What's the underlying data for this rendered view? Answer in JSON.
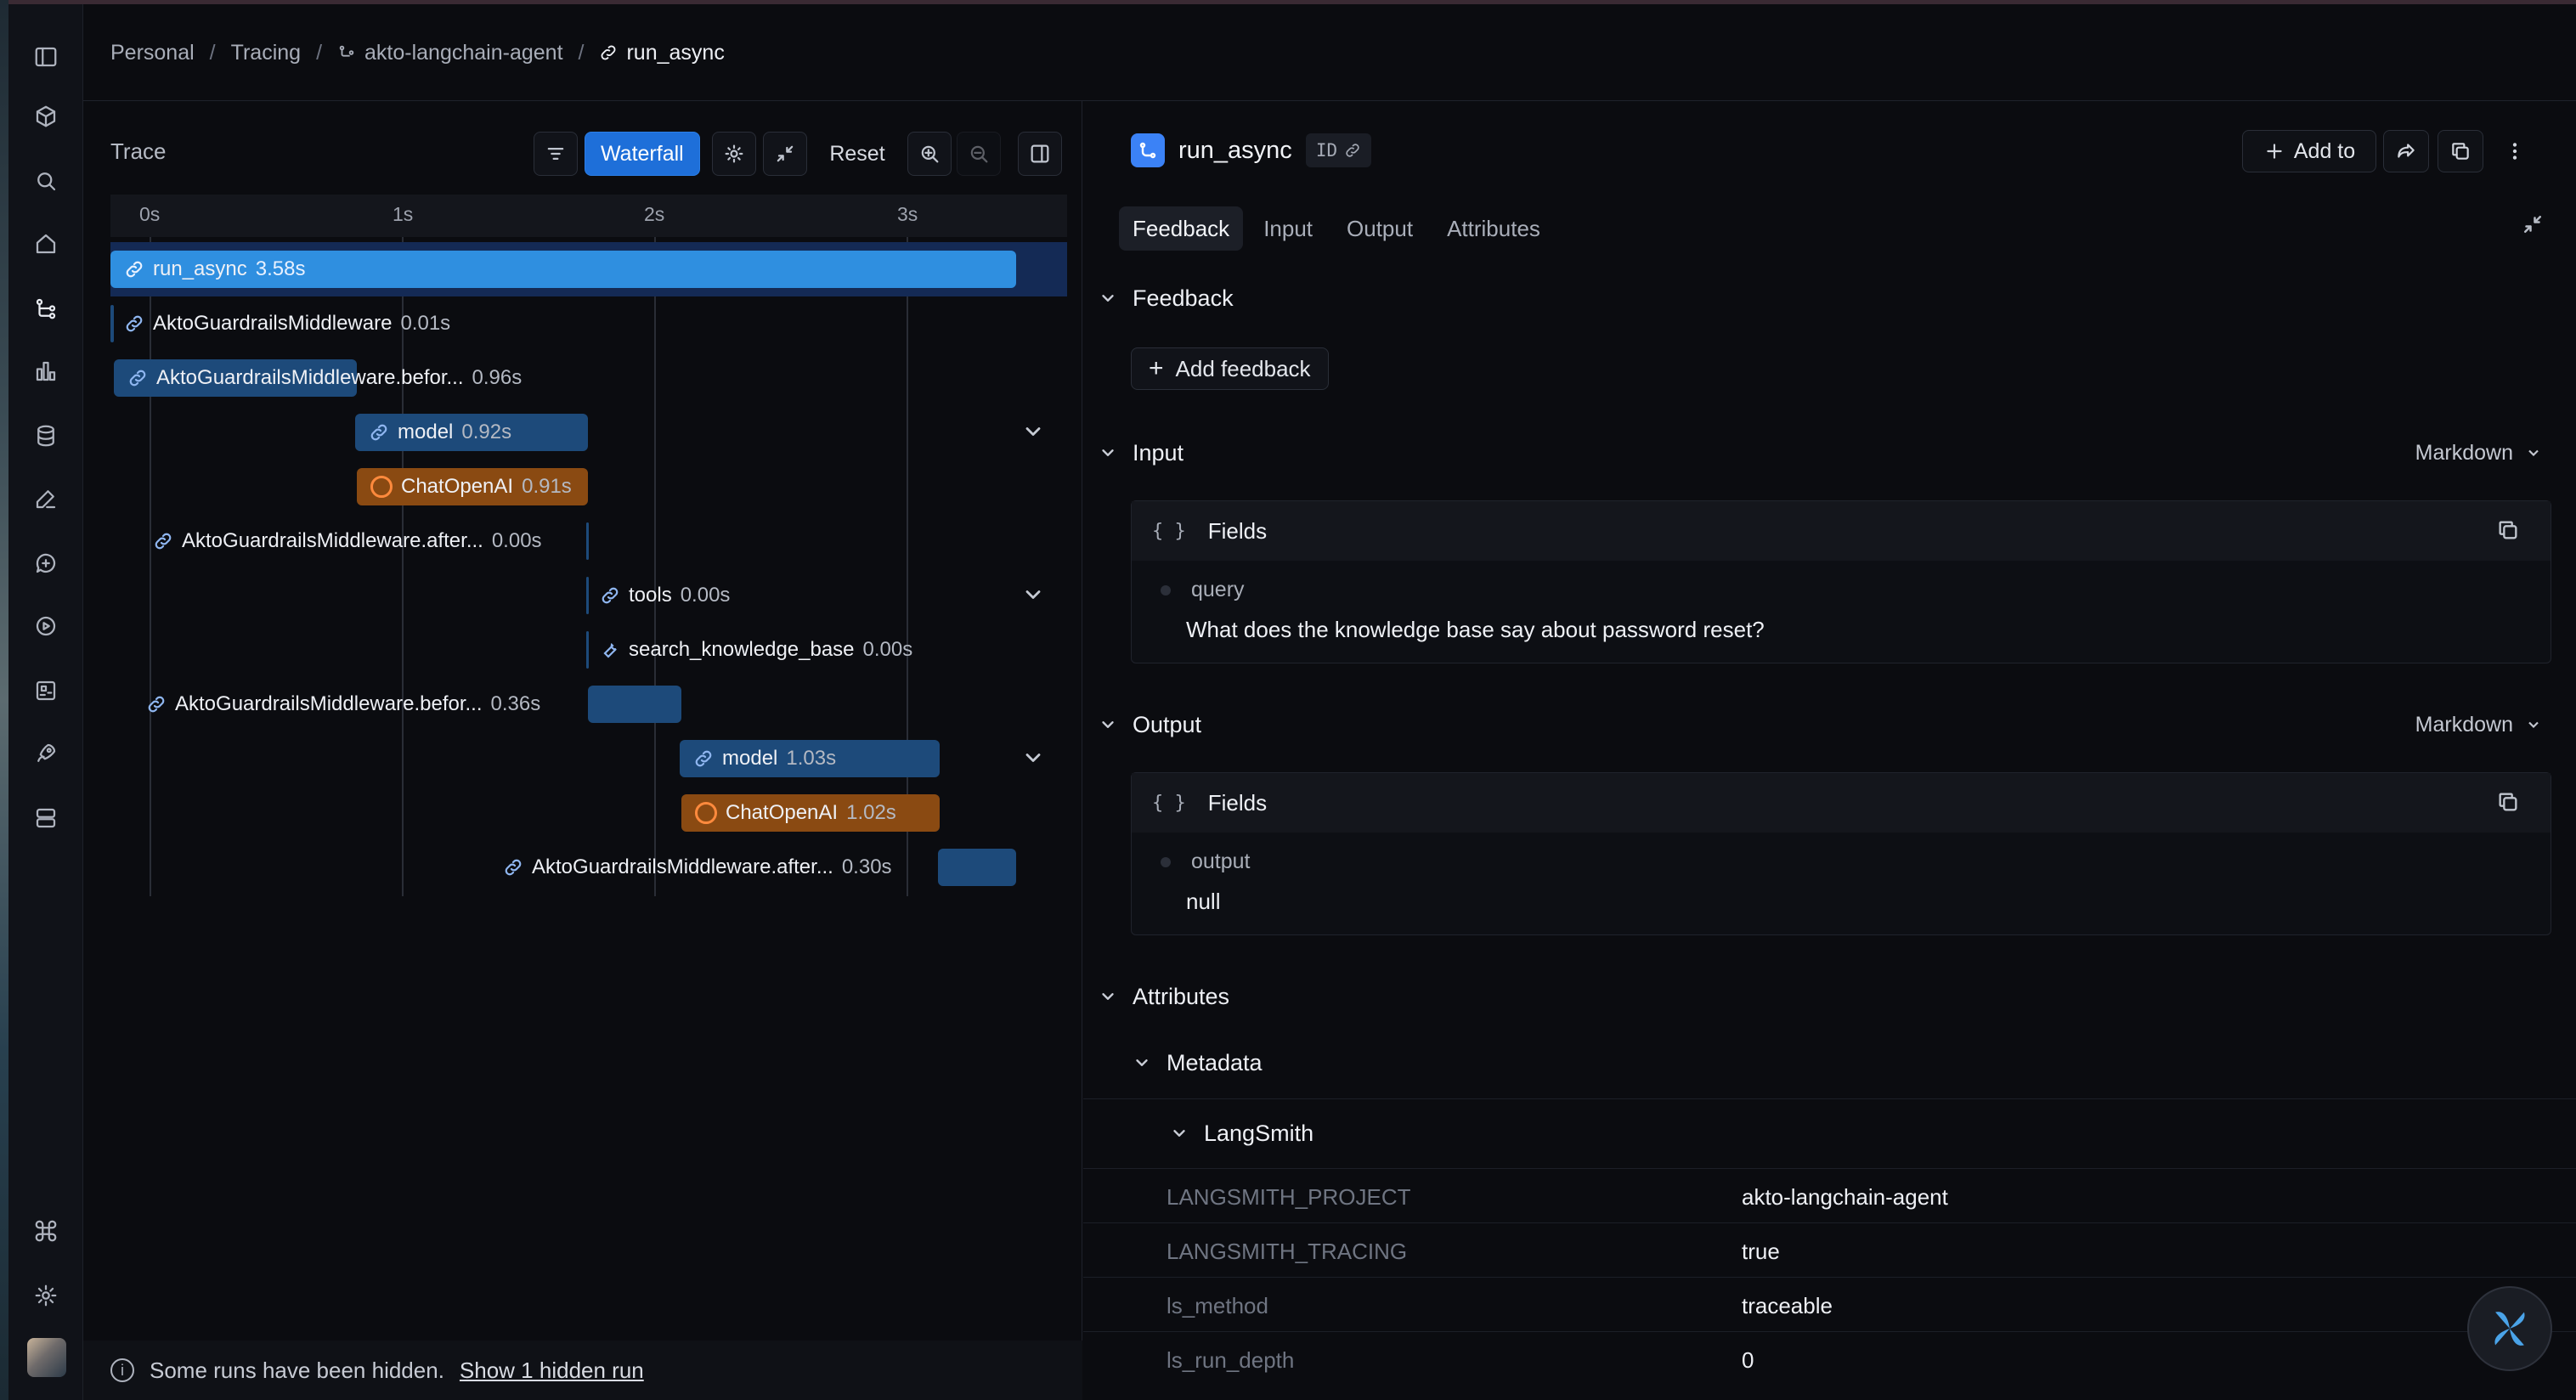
{
  "breadcrumb": {
    "items": [
      "Personal",
      "Tracing",
      "akto-langchain-agent",
      "run_async"
    ],
    "separator": "/"
  },
  "trace_panel": {
    "title": "Trace",
    "waterfall_label": "Waterfall",
    "reset_label": "Reset",
    "ticks": [
      "0s",
      "1s",
      "2s",
      "3s"
    ],
    "rows": [
      {
        "name": "run_async",
        "duration": "3.58s",
        "type": "chain"
      },
      {
        "name": "AktoGuardrailsMiddleware",
        "duration": "0.01s",
        "type": "chain"
      },
      {
        "name": "AktoGuardrailsMiddleware.befor...",
        "duration": "0.96s",
        "type": "chain"
      },
      {
        "name": "model",
        "duration": "0.92s",
        "type": "chain"
      },
      {
        "name": "ChatOpenAI",
        "duration": "0.91s",
        "type": "llm"
      },
      {
        "name": "AktoGuardrailsMiddleware.after...",
        "duration": "0.00s",
        "type": "chain"
      },
      {
        "name": "tools",
        "duration": "0.00s",
        "type": "chain"
      },
      {
        "name": "search_knowledge_base",
        "duration": "0.00s",
        "type": "tool"
      },
      {
        "name": "AktoGuardrailsMiddleware.befor...",
        "duration": "0.36s",
        "type": "chain"
      },
      {
        "name": "model",
        "duration": "1.03s",
        "type": "chain"
      },
      {
        "name": "ChatOpenAI",
        "duration": "1.02s",
        "type": "llm"
      },
      {
        "name": "AktoGuardrailsMiddleware.after...",
        "duration": "0.30s",
        "type": "chain"
      }
    ],
    "hidden_note": "Some runs have been hidden.",
    "hidden_link": "Show 1 hidden run"
  },
  "detail": {
    "run_name": "run_async",
    "id_badge": "ID",
    "add_to_label": "Add to",
    "tabs": [
      "Feedback",
      "Input",
      "Output",
      "Attributes"
    ],
    "active_tab": "Feedback",
    "feedback": {
      "heading": "Feedback",
      "add_label": "Add feedback"
    },
    "input": {
      "heading": "Input",
      "format": "Markdown",
      "fields_label": "Fields",
      "brace": "{ }",
      "key": "query",
      "value": "What does the knowledge base say about password reset?"
    },
    "output": {
      "heading": "Output",
      "format": "Markdown",
      "fields_label": "Fields",
      "brace": "{ }",
      "key": "output",
      "value": "null"
    },
    "attributes": {
      "heading": "Attributes",
      "metadata_heading": "Metadata",
      "langsmith_heading": "LangSmith",
      "rows": [
        {
          "key": "LANGSMITH_PROJECT",
          "value": "akto-langchain-agent"
        },
        {
          "key": "LANGSMITH_TRACING",
          "value": "true"
        },
        {
          "key": "ls_method",
          "value": "traceable"
        },
        {
          "key": "ls_run_depth",
          "value": "0"
        }
      ]
    }
  },
  "colors": {
    "accent": "#1e6fd9",
    "chain_bar": "#1d4a7a",
    "root_bar": "#2f8fe0",
    "llm_bar": "#8a4a12",
    "selected_row": "#142a55"
  }
}
